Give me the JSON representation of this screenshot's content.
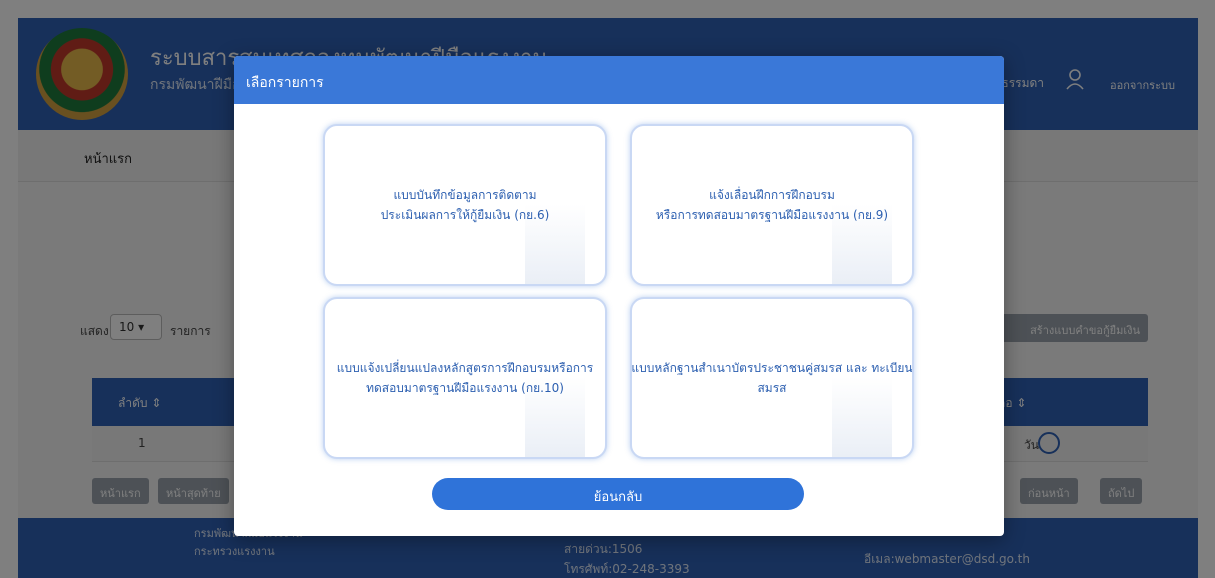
{
  "header": {
    "title": "ระบบสารสนเทศกองทุนพัฒนาฝีมือแรงงาน",
    "subtitle": "กรมพัฒนาฝีมือแรงงาน",
    "user_name": "คลธรรมดา",
    "logout": "ออกจากระบบ"
  },
  "nav": {
    "home": "หน้าแรก"
  },
  "listing": {
    "show_label": "แสดง",
    "page_size": "10",
    "records_label": "รายการ",
    "create_button": "สร้างแบบคำขอกู้ยืมเงิน",
    "columns": {
      "seq": "ลำดับ",
      "right": "ลอ"
    },
    "rows": [
      {
        "seq": "1",
        "right": "วัน"
      }
    ],
    "pagination": {
      "first": "หน้าแรก",
      "last": "หน้าสุดท้าย",
      "prev": "ก่อนหน้า",
      "next": "ถัดไป"
    }
  },
  "footer": {
    "org": "กรมพัฒนาฝีมือแรงงาน",
    "ministry": "กระทรวงแรงงาน",
    "hotline": "สายด่วน:1506",
    "phone": "โทรศัพท์:02-248-3393",
    "email": "อีเมล:webmaster@dsd.go.th"
  },
  "modal": {
    "title": "เลือกรายการ",
    "cards": [
      {
        "line1": "แบบบันทึกข้อมูลการติดตาม",
        "line2": "ประเมินผลการให้กู้ยืมเงิน (กย.6)"
      },
      {
        "line1": "แจ้งเลื่อนฝึกการฝึกอบรม",
        "line2": "หรือการทดสอบมาตรฐานฝีมือแรงงาน (กย.9)"
      },
      {
        "line1": "แบบแจ้งเปลี่ยนแปลงหลักสูตรการฝึกอบรมหรือการ",
        "line2": "ทดสอบมาตรฐานฝีมือแรงงาน (กย.10)"
      },
      {
        "line1": "แบบหลักฐานสำเนาบัตรประชาชนคู่สมรส และ ทะเบียน",
        "line2": "สมรส"
      }
    ],
    "back_button": "ย้อนกลับ"
  },
  "colors": {
    "header_blue": "#2f61b5",
    "modal_header": "#3a78d8",
    "card_text": "#2c5fb0",
    "back_button": "#2f73d9"
  }
}
